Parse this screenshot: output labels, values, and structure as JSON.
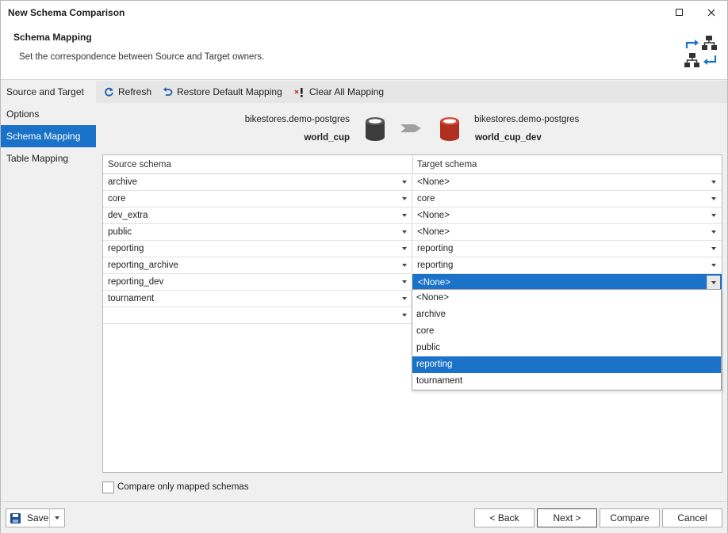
{
  "window": {
    "title": "New Schema Comparison"
  },
  "header": {
    "title": "Schema Mapping",
    "subtitle": "Set the correspondence between Source and Target owners."
  },
  "sidebar": {
    "items": [
      {
        "label": "Source and Target"
      },
      {
        "label": "Options"
      },
      {
        "label": "Schema Mapping"
      },
      {
        "label": "Table Mapping"
      }
    ]
  },
  "toolbar": {
    "refresh_label": "Refresh",
    "restore_label": "Restore Default Mapping",
    "clear_label": "Clear All Mapping"
  },
  "connection": {
    "source_server": "bikestores.demo-postgres",
    "source_db": "world_cup",
    "target_server": "bikestores.demo-postgres",
    "target_db": "world_cup_dev"
  },
  "grid": {
    "source_header": "Source schema",
    "target_header": "Target schema",
    "rows": [
      {
        "source": "archive",
        "target": "<None>"
      },
      {
        "source": "core",
        "target": "core"
      },
      {
        "source": "dev_extra",
        "target": "<None>"
      },
      {
        "source": "public",
        "target": "<None>"
      },
      {
        "source": "reporting",
        "target": "reporting"
      },
      {
        "source": "reporting_archive",
        "target": "reporting"
      },
      {
        "source": "reporting_dev",
        "target": "<None>"
      },
      {
        "source": "tournament",
        "target": ""
      },
      {
        "source": "",
        "target": ""
      }
    ]
  },
  "dropdown": {
    "options": [
      "<None>",
      "archive",
      "core",
      "public",
      "reporting",
      "tournament"
    ]
  },
  "compare_only_mapped_label": "Compare only mapped schemas",
  "footer": {
    "save_label": "Save",
    "back_label": "< Back",
    "next_label": "Next >",
    "compare_label": "Compare",
    "cancel_label": "Cancel"
  },
  "colors": {
    "accent": "#1a73c8",
    "source_db": "#3c3c3c",
    "target_db": "#b0301f"
  }
}
